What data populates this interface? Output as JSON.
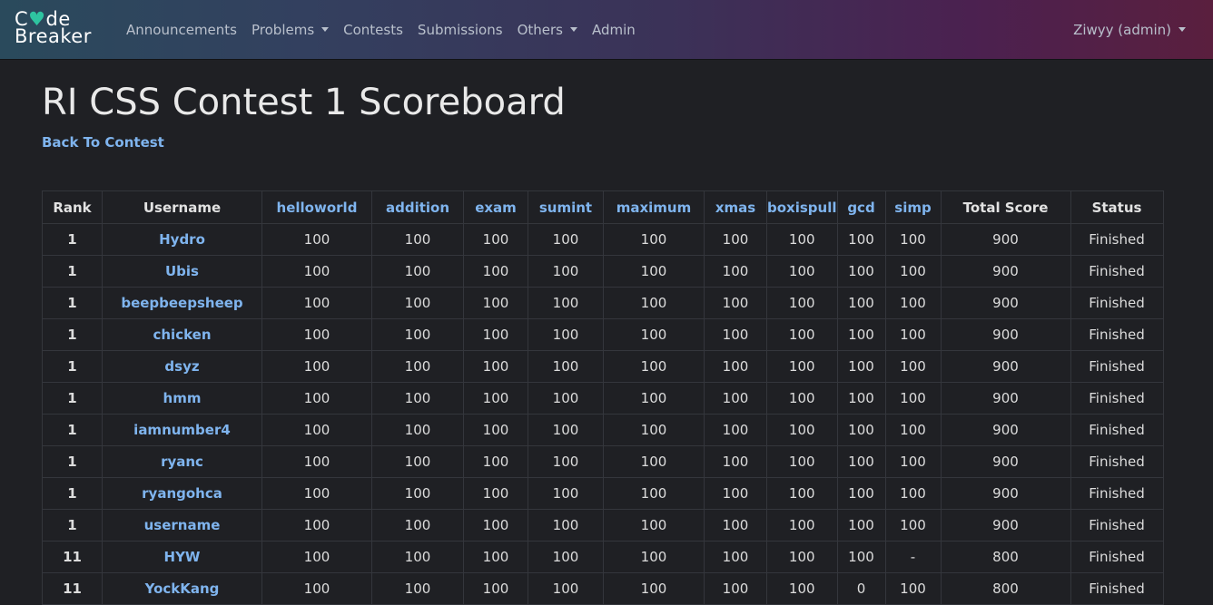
{
  "nav": {
    "logo_line1_a": "C",
    "logo_heart": "♥",
    "logo_line1_b": "de",
    "logo_line2": "Breaker",
    "items": [
      {
        "label": "Announcements",
        "dropdown": false
      },
      {
        "label": "Problems",
        "dropdown": true
      },
      {
        "label": "Contests",
        "dropdown": false
      },
      {
        "label": "Submissions",
        "dropdown": false
      },
      {
        "label": "Others",
        "dropdown": true
      },
      {
        "label": "Admin",
        "dropdown": false
      }
    ],
    "user": "Ziwyy (admin)"
  },
  "page": {
    "title": "RI CSS Contest 1 Scoreboard",
    "back_link": "Back To Contest"
  },
  "table": {
    "headers": {
      "rank": "Rank",
      "username": "Username",
      "total": "Total Score",
      "status": "Status"
    },
    "problems": [
      "helloworld",
      "addition",
      "exam",
      "sumint",
      "maximum",
      "xmas",
      "boxispull",
      "gcd",
      "simp"
    ],
    "rows": [
      {
        "rank": "1",
        "username": "Hydro",
        "scores": [
          "100",
          "100",
          "100",
          "100",
          "100",
          "100",
          "100",
          "100",
          "100"
        ],
        "total": "900",
        "status": "Finished"
      },
      {
        "rank": "1",
        "username": "Ubis",
        "scores": [
          "100",
          "100",
          "100",
          "100",
          "100",
          "100",
          "100",
          "100",
          "100"
        ],
        "total": "900",
        "status": "Finished"
      },
      {
        "rank": "1",
        "username": "beepbeepsheep",
        "scores": [
          "100",
          "100",
          "100",
          "100",
          "100",
          "100",
          "100",
          "100",
          "100"
        ],
        "total": "900",
        "status": "Finished"
      },
      {
        "rank": "1",
        "username": "chicken",
        "scores": [
          "100",
          "100",
          "100",
          "100",
          "100",
          "100",
          "100",
          "100",
          "100"
        ],
        "total": "900",
        "status": "Finished"
      },
      {
        "rank": "1",
        "username": "dsyz",
        "scores": [
          "100",
          "100",
          "100",
          "100",
          "100",
          "100",
          "100",
          "100",
          "100"
        ],
        "total": "900",
        "status": "Finished"
      },
      {
        "rank": "1",
        "username": "hmm",
        "scores": [
          "100",
          "100",
          "100",
          "100",
          "100",
          "100",
          "100",
          "100",
          "100"
        ],
        "total": "900",
        "status": "Finished"
      },
      {
        "rank": "1",
        "username": "iamnumber4",
        "scores": [
          "100",
          "100",
          "100",
          "100",
          "100",
          "100",
          "100",
          "100",
          "100"
        ],
        "total": "900",
        "status": "Finished"
      },
      {
        "rank": "1",
        "username": "ryanc",
        "scores": [
          "100",
          "100",
          "100",
          "100",
          "100",
          "100",
          "100",
          "100",
          "100"
        ],
        "total": "900",
        "status": "Finished"
      },
      {
        "rank": "1",
        "username": "ryangohca",
        "scores": [
          "100",
          "100",
          "100",
          "100",
          "100",
          "100",
          "100",
          "100",
          "100"
        ],
        "total": "900",
        "status": "Finished"
      },
      {
        "rank": "1",
        "username": "username",
        "scores": [
          "100",
          "100",
          "100",
          "100",
          "100",
          "100",
          "100",
          "100",
          "100"
        ],
        "total": "900",
        "status": "Finished"
      },
      {
        "rank": "11",
        "username": "HYW",
        "scores": [
          "100",
          "100",
          "100",
          "100",
          "100",
          "100",
          "100",
          "100",
          "-"
        ],
        "total": "800",
        "status": "Finished"
      },
      {
        "rank": "11",
        "username": "YockKang",
        "scores": [
          "100",
          "100",
          "100",
          "100",
          "100",
          "100",
          "100",
          "0",
          "100"
        ],
        "total": "800",
        "status": "Finished"
      }
    ]
  },
  "colors": {
    "link": "#7fb4ee",
    "background": "#1f2024",
    "logo_accent": "#2ec4a0"
  }
}
